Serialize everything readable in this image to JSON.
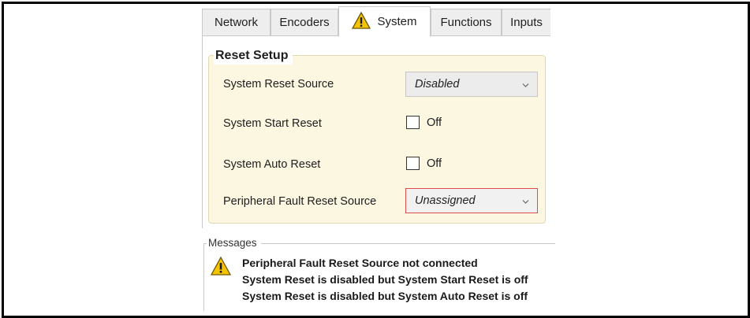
{
  "tabs": [
    {
      "label": "Network",
      "active": false,
      "warning": false
    },
    {
      "label": "Encoders",
      "active": false,
      "warning": false
    },
    {
      "label": "System",
      "active": true,
      "warning": true
    },
    {
      "label": "Functions",
      "active": false,
      "warning": false
    },
    {
      "label": "Inputs",
      "active": false,
      "warning": false
    }
  ],
  "reset_setup": {
    "title": "Reset Setup",
    "system_reset_source": {
      "label": "System Reset Source",
      "value": "Disabled"
    },
    "system_start_reset": {
      "label": "System Start Reset",
      "checked": false,
      "state_text": "Off"
    },
    "system_auto_reset": {
      "label": "System Auto Reset",
      "checked": false,
      "state_text": "Off"
    },
    "peripheral_fault_reset_source": {
      "label": "Peripheral Fault Reset Source",
      "value": "Unassigned",
      "error": true
    }
  },
  "messages": {
    "title": "Messages",
    "items": [
      "Peripheral Fault Reset Source not connected",
      "System Reset is disabled but System Start Reset is off",
      "System Reset is disabled but System Auto Reset is off"
    ]
  },
  "colors": {
    "group_background": "#fcf7e1",
    "error_border": "#e04b4b",
    "warning_yellow": "#f5c400"
  },
  "icons": {
    "warning": "warning-triangle-icon",
    "dropdown": "chevron-down-icon"
  }
}
